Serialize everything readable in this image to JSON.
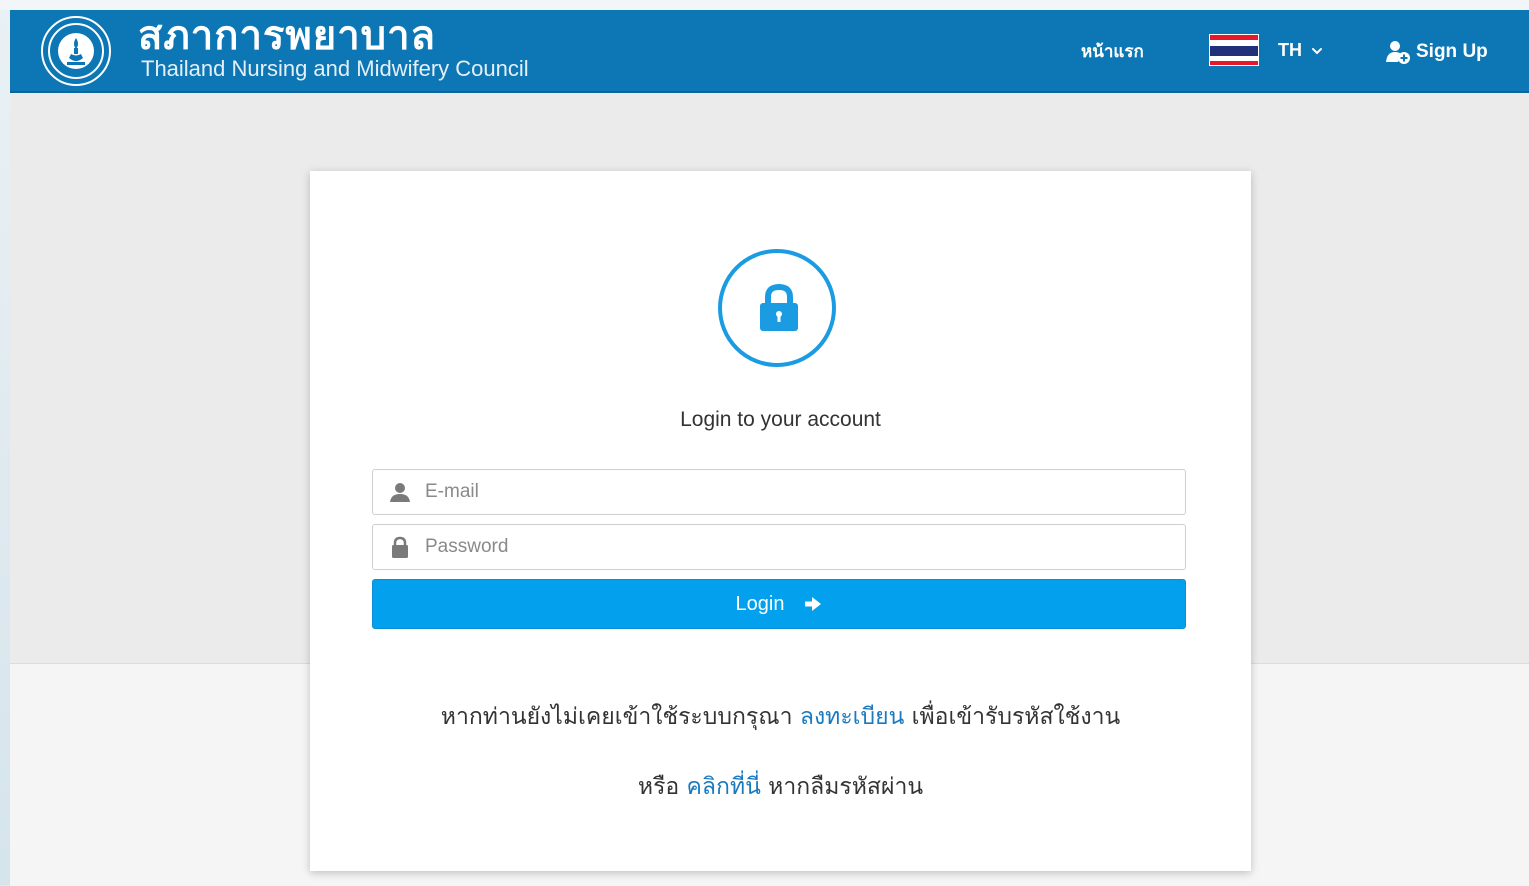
{
  "header": {
    "brand_thai": "สภาการพยาบาล",
    "brand_english": "Thailand Nursing and Midwifery Council",
    "home_link": "หน้าแรก",
    "language": "TH",
    "signup_label": "Sign Up"
  },
  "login": {
    "title": "Login to your account",
    "email_placeholder": "E-mail",
    "password_placeholder": "Password",
    "login_button": "Login"
  },
  "info": {
    "line1_prefix": "หากท่านยังไม่เคยเข้าใช้ระบบกรุณา",
    "register_link": "ลงทะเบียน",
    "line1_suffix": "เพื่อเข้ารับรหัสใช้งาน",
    "line2_prefix": "หรือ",
    "forgot_link": "คลิกที่นี่",
    "line2_suffix": "หากลืมรหัสผ่าน"
  },
  "colors": {
    "header_bg": "#0d77b5",
    "accent_blue": "#1b9ce2",
    "button_bg": "#03a1ed",
    "link_color": "#1a7ac0"
  },
  "icons": {
    "logo": "council-seal-logo",
    "flag": "thai-flag-icon",
    "language_dropdown": "chevron-down-icon",
    "signup": "add-user-icon",
    "card_lock": "lock-icon",
    "email": "user-icon",
    "password": "lock-icon",
    "login_arrow": "arrow-right-icon"
  }
}
